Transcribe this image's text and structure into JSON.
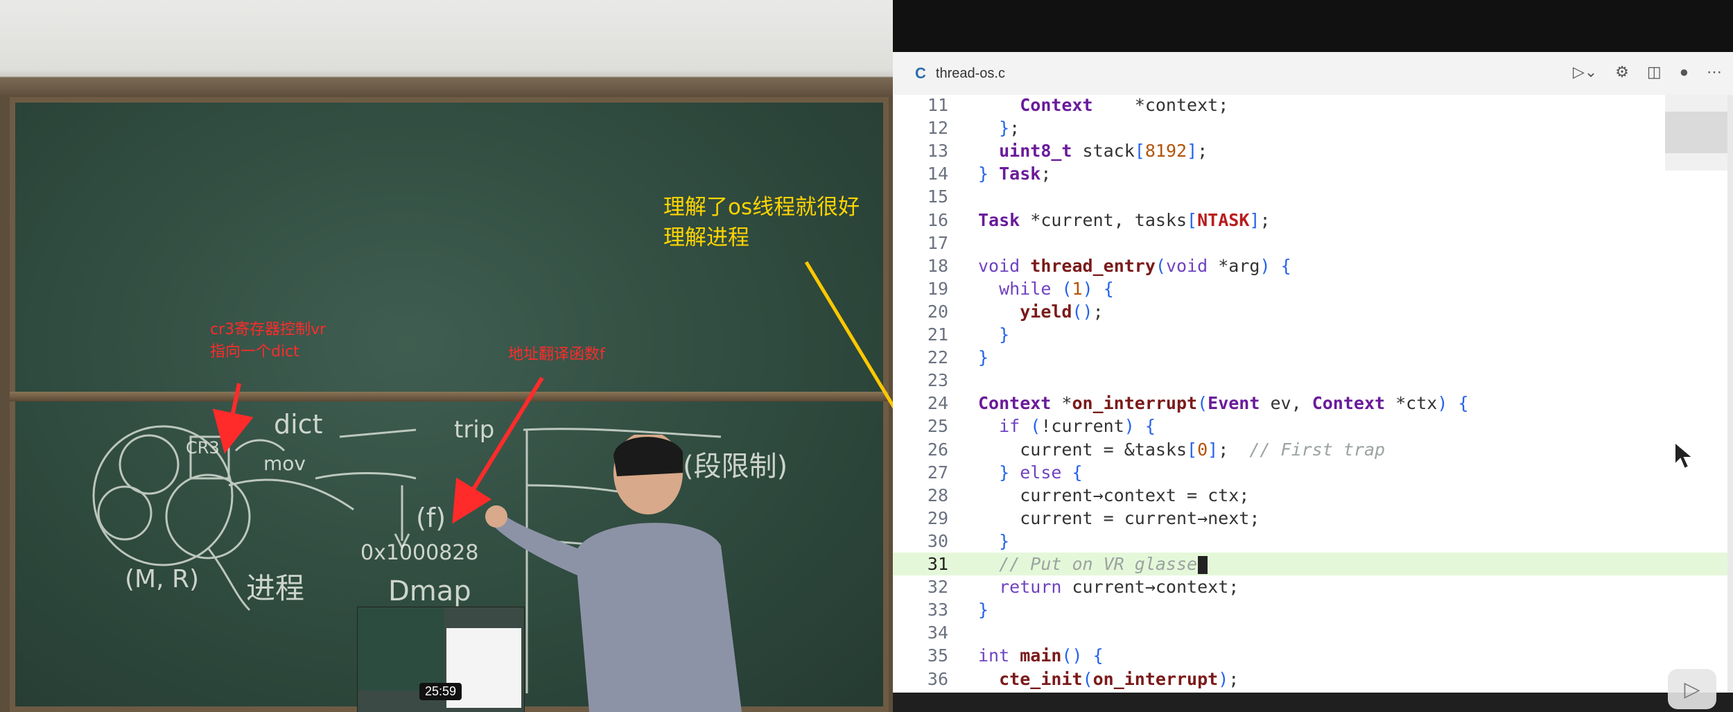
{
  "video": {
    "thumbnail_time": "25:59"
  },
  "annotations": {
    "cr3_line1": "cr3寄存器控制vr",
    "cr3_line2": "指向一个dict",
    "addr_translate": "地址翻译函数f",
    "process_line1": "理解了os线程就很好",
    "process_line2": "理解进程"
  },
  "chalkboard": {
    "dict": "dict",
    "cr3": "CR3",
    "mov": "mov",
    "call": "(f)",
    "addr": "0x1000828",
    "process": "进程",
    "dmap": "Dmap",
    "mr": "(M, R)",
    "limit": "(段限制)",
    "trip": "trip"
  },
  "editor": {
    "tab_title": "thread-os.c",
    "tab_lang_icon": "C",
    "icons": [
      "run-icon",
      "gear-icon",
      "split-icon",
      "dot-icon",
      "more-icon"
    ],
    "lines": [
      {
        "n": "11",
        "code": "    Context    *context;"
      },
      {
        "n": "12",
        "code": "  };"
      },
      {
        "n": "13",
        "code": "  uint8_t stack[8192];"
      },
      {
        "n": "14",
        "code": "} Task;"
      },
      {
        "n": "15",
        "code": ""
      },
      {
        "n": "16",
        "code": "Task *current, tasks[NTASK];"
      },
      {
        "n": "17",
        "code": ""
      },
      {
        "n": "18",
        "code": "void thread_entry(void *arg) {"
      },
      {
        "n": "19",
        "code": "  while (1) {"
      },
      {
        "n": "20",
        "code": "    yield();"
      },
      {
        "n": "21",
        "code": "  }"
      },
      {
        "n": "22",
        "code": "}"
      },
      {
        "n": "23",
        "code": ""
      },
      {
        "n": "24",
        "code": "Context *on_interrupt(Event ev, Context *ctx) {"
      },
      {
        "n": "25",
        "code": "  if (!current) {"
      },
      {
        "n": "26",
        "code": "    current = &tasks[0];  // First trap"
      },
      {
        "n": "27",
        "code": "  } else {"
      },
      {
        "n": "28",
        "code": "    current→context = ctx;"
      },
      {
        "n": "29",
        "code": "    current = current→next;"
      },
      {
        "n": "30",
        "code": "  }"
      },
      {
        "n": "31",
        "code": "  // Put on VR glasses"
      },
      {
        "n": "32",
        "code": "  return current→context;"
      },
      {
        "n": "33",
        "code": "}"
      },
      {
        "n": "34",
        "code": ""
      },
      {
        "n": "35",
        "code": "int main() {"
      },
      {
        "n": "36",
        "code": "  cte_init(on_interrupt);"
      }
    ]
  },
  "colors": {
    "annotation_red": "#ff2b2b",
    "annotation_yellow": "#ffd400",
    "highlight_line": "#e4f8d9"
  }
}
